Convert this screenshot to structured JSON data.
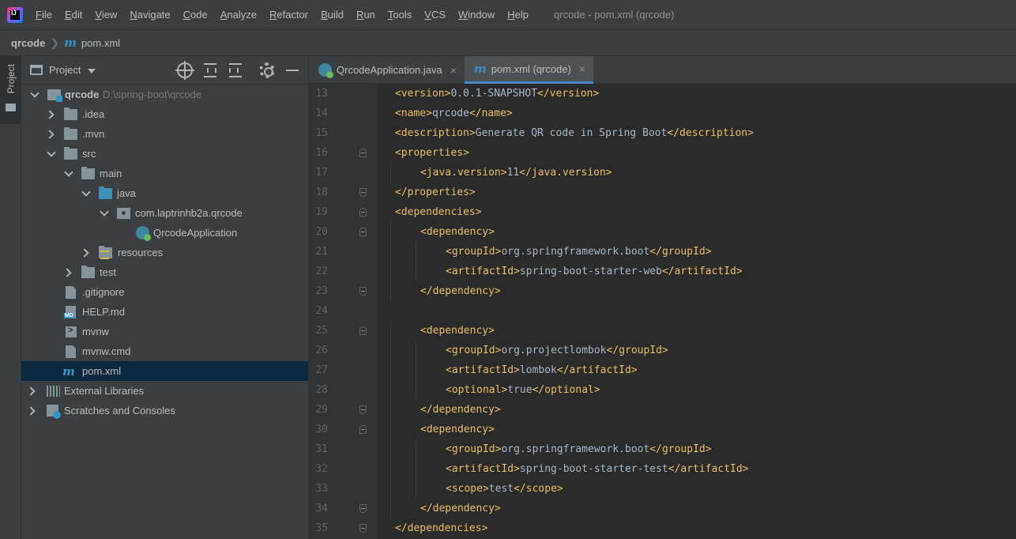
{
  "menubar": {
    "items": [
      "File",
      "Edit",
      "View",
      "Navigate",
      "Code",
      "Analyze",
      "Refactor",
      "Build",
      "Run",
      "Tools",
      "VCS",
      "Window",
      "Help"
    ],
    "window_title": "qrcode - pom.xml (qrcode)"
  },
  "breadcrumb": {
    "project": "qrcode",
    "file": "pom.xml"
  },
  "tool_stripe": {
    "project_label": "Project"
  },
  "project_panel": {
    "title": "Project",
    "tree": {
      "root_name": "qrcode",
      "root_path": "D:\\spring-boot\\qrcode",
      "idea": ".idea",
      "mvn": ".mvn",
      "src": "src",
      "main": "main",
      "java": "java",
      "package": "com.laptrinhb2a.qrcode",
      "app_class": "QrcodeApplication",
      "resources": "resources",
      "test": "test",
      "gitignore": ".gitignore",
      "help": "HELP.md",
      "mvnw": "mvnw",
      "mvnw_cmd": "mvnw.cmd",
      "pom": "pom.xml",
      "external_libraries": "External Libraries",
      "scratches": "Scratches and Consoles"
    }
  },
  "editor": {
    "tabs": [
      {
        "label": "QrcodeApplication.java",
        "close": "×"
      },
      {
        "label": "pom.xml (qrcode)",
        "close": "×"
      }
    ],
    "lines": [
      {
        "n": "13",
        "indent": 1,
        "open": "<version>",
        "text": "0.0.1-SNAPSHOT",
        "close": "</version>"
      },
      {
        "n": "14",
        "indent": 1,
        "open": "<name>",
        "text": "qrcode",
        "close": "</name>"
      },
      {
        "n": "15",
        "indent": 1,
        "open": "<description>",
        "text": "Generate QR code in Spring Boot",
        "close": "</description>"
      },
      {
        "n": "16",
        "indent": 1,
        "open": "<properties>",
        "text": "",
        "close": ""
      },
      {
        "n": "17",
        "indent": 2,
        "open": "<java.version>",
        "text": "11",
        "close": "</java.version>"
      },
      {
        "n": "18",
        "indent": 1,
        "open": "</properties>",
        "text": "",
        "close": ""
      },
      {
        "n": "19",
        "indent": 1,
        "open": "<dependencies>",
        "text": "",
        "close": ""
      },
      {
        "n": "20",
        "indent": 2,
        "open": "<dependency>",
        "text": "",
        "close": ""
      },
      {
        "n": "21",
        "indent": 3,
        "open": "<groupId>",
        "text": "org.springframework.boot",
        "close": "</groupId>"
      },
      {
        "n": "22",
        "indent": 3,
        "open": "<artifactId>",
        "text": "spring-boot-starter-web",
        "close": "</artifactId>"
      },
      {
        "n": "23",
        "indent": 2,
        "open": "</dependency>",
        "text": "",
        "close": ""
      },
      {
        "n": "24",
        "indent": 0,
        "open": "",
        "text": "",
        "close": ""
      },
      {
        "n": "25",
        "indent": 2,
        "open": "<dependency>",
        "text": "",
        "close": ""
      },
      {
        "n": "26",
        "indent": 3,
        "open": "<groupId>",
        "text": "org.projectlombok",
        "close": "</groupId>"
      },
      {
        "n": "27",
        "indent": 3,
        "open": "<artifactId>",
        "text": "lombok",
        "close": "</artifactId>"
      },
      {
        "n": "28",
        "indent": 3,
        "open": "<optional>",
        "text": "true",
        "close": "</optional>"
      },
      {
        "n": "29",
        "indent": 2,
        "open": "</dependency>",
        "text": "",
        "close": ""
      },
      {
        "n": "30",
        "indent": 2,
        "open": "<dependency>",
        "text": "",
        "close": ""
      },
      {
        "n": "31",
        "indent": 3,
        "open": "<groupId>",
        "text": "org.springframework.boot",
        "close": "</groupId>"
      },
      {
        "n": "32",
        "indent": 3,
        "open": "<artifactId>",
        "text": "spring-boot-starter-test",
        "close": "</artifactId>"
      },
      {
        "n": "33",
        "indent": 3,
        "open": "<scope>",
        "text": "test",
        "close": "</scope>"
      },
      {
        "n": "34",
        "indent": 2,
        "open": "</dependency>",
        "text": "",
        "close": ""
      },
      {
        "n": "35",
        "indent": 1,
        "open": "</dependencies>",
        "text": "",
        "close": ""
      }
    ]
  },
  "colors": {
    "tag": "#e8bf6a",
    "text": "#a9b7c6",
    "accent": "#4a88c7",
    "selection": "#0d293e"
  }
}
